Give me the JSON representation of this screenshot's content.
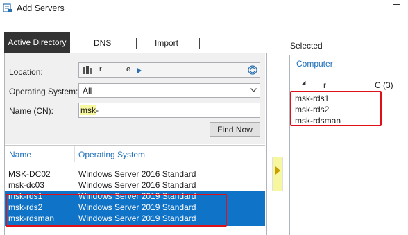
{
  "window": {
    "title": "Add Servers"
  },
  "tabs": [
    {
      "label": "Active Directory",
      "active": true
    },
    {
      "label": "DNS",
      "active": false
    },
    {
      "label": "Import",
      "active": false
    }
  ],
  "search": {
    "location_label": "Location:",
    "location_value_1": "r",
    "location_value_2": "e",
    "os_label": "Operating System:",
    "os_value": "All",
    "name_label": "Name (CN):",
    "name_value_hl": "msk",
    "name_value_rest": "-",
    "find_button": "Find Now"
  },
  "results": {
    "headers": [
      "Name",
      "Operating System"
    ],
    "rows": [
      {
        "name": "MSK-DC02",
        "os": "Windows Server 2016 Standard",
        "selected": false
      },
      {
        "name": "msk-dc03",
        "os": "Windows Server 2016 Standard",
        "selected": false
      },
      {
        "name": "msk-rds1",
        "os": "Windows Server 2019 Standard",
        "selected": true
      },
      {
        "name": "msk-rds2",
        "os": "Windows Server 2019 Standard",
        "selected": true
      },
      {
        "name": "msk-rdsman",
        "os": "Windows Server 2019 Standard",
        "selected": true
      }
    ]
  },
  "selected_panel": {
    "label": "Selected",
    "column_header": "Computer",
    "group_name": "r",
    "group_count": "C (3)",
    "items": [
      "msk-rds1",
      "msk-rds2",
      "msk-rdsman"
    ]
  },
  "colors": {
    "selection": "#0f73c7",
    "annotation": "#e0101a",
    "link": "#1e6fba"
  }
}
